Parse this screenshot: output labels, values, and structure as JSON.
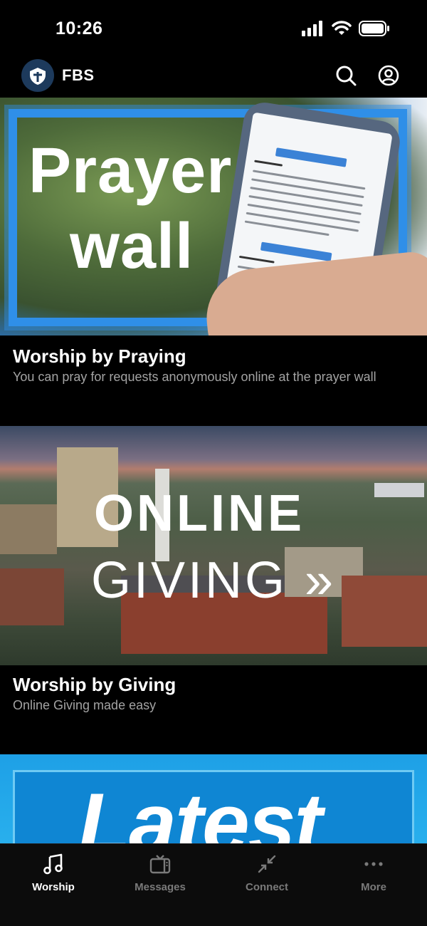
{
  "status_bar": {
    "time": "10:26",
    "icons": [
      "cellular-signal-icon",
      "wifi-icon",
      "battery-icon"
    ]
  },
  "header": {
    "title": "FBS",
    "logo_icon": "church-logo-icon",
    "search_icon": "search-icon",
    "profile_icon": "user-profile-icon"
  },
  "cards": [
    {
      "title": "Worship by Praying",
      "subtitle": "You can pray for requests anonymously online at the prayer wall",
      "image": {
        "line1": "Prayer",
        "line2": "wall",
        "phone_text": {
          "button": "I PRAYED FOR THIS",
          "name": "Gerald",
          "message": "Thank You Lord Jesus Christ! Hallelujah! He saved our son & He was baptized on yesterday. God is restoring our relationships & family. Thank you for praying & please keep praying for us. God bless you always!",
          "name2": "Passion",
          "message2": "-God to heal and deliver my mother from her sickness"
        }
      }
    },
    {
      "title": "Worship by Giving",
      "subtitle": "Online Giving made easy",
      "image": {
        "line1": "ONLINE",
        "line2": "GIVING »"
      }
    },
    {
      "title": "",
      "subtitle": "",
      "image": {
        "line1": "Latest"
      }
    }
  ],
  "tab_bar": {
    "tabs": [
      {
        "label": "Worship",
        "icon": "music-note-icon",
        "active": true
      },
      {
        "label": "Messages",
        "icon": "tv-icon",
        "active": false
      },
      {
        "label": "Connect",
        "icon": "arrows-inward-icon",
        "active": false
      },
      {
        "label": "More",
        "icon": "more-dots-icon",
        "active": false
      }
    ]
  },
  "colors": {
    "background": "#000000",
    "subtitle_text": "#a3a3a3",
    "tab_inactive": "#7a7a7a",
    "prayer_frame_blue": "#2f8fe8",
    "latest_blue": "#1ea0e6",
    "logo_navy": "#1d3a5c"
  }
}
